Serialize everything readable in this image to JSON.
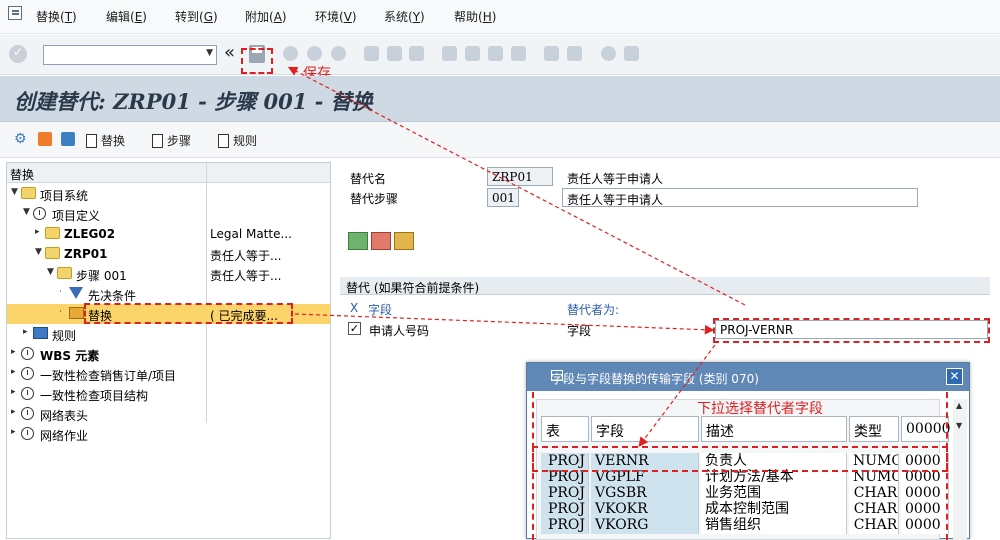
{
  "menu": {
    "items": [
      {
        "text": "替换(",
        "key": "T",
        "end": ")"
      },
      {
        "text": "编辑(",
        "key": "E",
        "end": ")"
      },
      {
        "text": "转到(",
        "key": "G",
        "end": ")"
      },
      {
        "text": "附加(",
        "key": "A",
        "end": ")"
      },
      {
        "text": "环境(",
        "key": "V",
        "end": ")"
      },
      {
        "text": "系统(",
        "key": "Y",
        "end": ")"
      },
      {
        "text": "帮助(",
        "key": "H",
        "end": ")"
      }
    ]
  },
  "toolbar": {
    "command_value": "",
    "back_symbol": "«"
  },
  "annotations": {
    "save": "保存",
    "dropdown_hint": "下拉选择替代者字段"
  },
  "title": "创建替代: ZRP01 - 步骤 001 - 替换",
  "app_toolbar": {
    "replace_label": "替换",
    "step_label": "步骤",
    "rule_label": "规则"
  },
  "tree": {
    "header": "替换",
    "rows": [
      {
        "label": "项目系统",
        "col2": "",
        "icon": "folder",
        "level": 0,
        "expand": "▼"
      },
      {
        "label": "项目定义",
        "col2": "",
        "icon": "clock",
        "level": 1,
        "expand": "▼"
      },
      {
        "label": "ZLEG02",
        "col2": "Legal Matte...",
        "icon": "folder",
        "level": 2,
        "expand": "▸"
      },
      {
        "label": "ZRP01",
        "col2": "责任人等于...",
        "icon": "folder",
        "level": 2,
        "expand": "▼"
      },
      {
        "label": "步骤 001",
        "col2": "责任人等于...",
        "icon": "folder",
        "level": 3,
        "expand": "▼"
      },
      {
        "label": "先决条件",
        "col2": "",
        "icon": "funnel",
        "level": 4,
        "expand": "·"
      },
      {
        "label": "替换",
        "col2": "( 已完成要...",
        "icon": "sub",
        "level": 4,
        "expand": "·"
      },
      {
        "label": "规则",
        "col2": "",
        "icon": "rule",
        "level": 1,
        "expand": "▸"
      },
      {
        "label": "WBS 元素",
        "col2": "",
        "icon": "clock",
        "level": 0,
        "expand": "▸"
      },
      {
        "label": "一致性检查销售订单/项目",
        "col2": "",
        "icon": "clock",
        "level": 0,
        "expand": "▸"
      },
      {
        "label": "一致性检查项目结构",
        "col2": "",
        "icon": "clock",
        "level": 0,
        "expand": "▸"
      },
      {
        "label": "网络表头",
        "col2": "",
        "icon": "clock",
        "level": 0,
        "expand": "▸"
      },
      {
        "label": "网络作业",
        "col2": "",
        "icon": "clock",
        "level": 0,
        "expand": "▸"
      }
    ]
  },
  "detail": {
    "sub_name_label": "替代名",
    "sub_name_value": "ZRP01",
    "sub_name_desc": "责任人等于申请人",
    "step_label": "替代步骤",
    "step_value": "001",
    "step_desc": "责任人等于申请人",
    "group_title": "替代 (如果符合前提条件)",
    "col_x": "X",
    "col_field": "字段",
    "col_sub_by": "替代者为:",
    "row_check": "✓",
    "row_field": "申请人号码",
    "row_type": "字段",
    "row_value": "PROJ-VERNR"
  },
  "popup": {
    "title": "字段与字段替换的传输字段 (类别 070)",
    "close": "✕",
    "headers": [
      "表",
      "字段",
      "描述",
      "类型",
      "00000"
    ],
    "rows": [
      [
        "PROJ",
        "VERNR",
        "负责人",
        "NUMC",
        "0000"
      ],
      [
        "PROJ",
        "VGPLF",
        "计划方法/基本",
        "NUMC",
        "0000"
      ],
      [
        "PROJ",
        "VGSBR",
        "业务范围",
        "CHAR",
        "0000"
      ],
      [
        "PROJ",
        "VKOKR",
        "成本控制范围",
        "CHAR",
        "0000"
      ],
      [
        "PROJ",
        "VKORG",
        "销售组织",
        "CHAR",
        "0000"
      ]
    ]
  },
  "colors": {
    "annotation": "#e02020",
    "title_bg": "#cfd9e3",
    "popup_title_bg": "#5f88b7",
    "selected_row": "#fbd56a"
  }
}
